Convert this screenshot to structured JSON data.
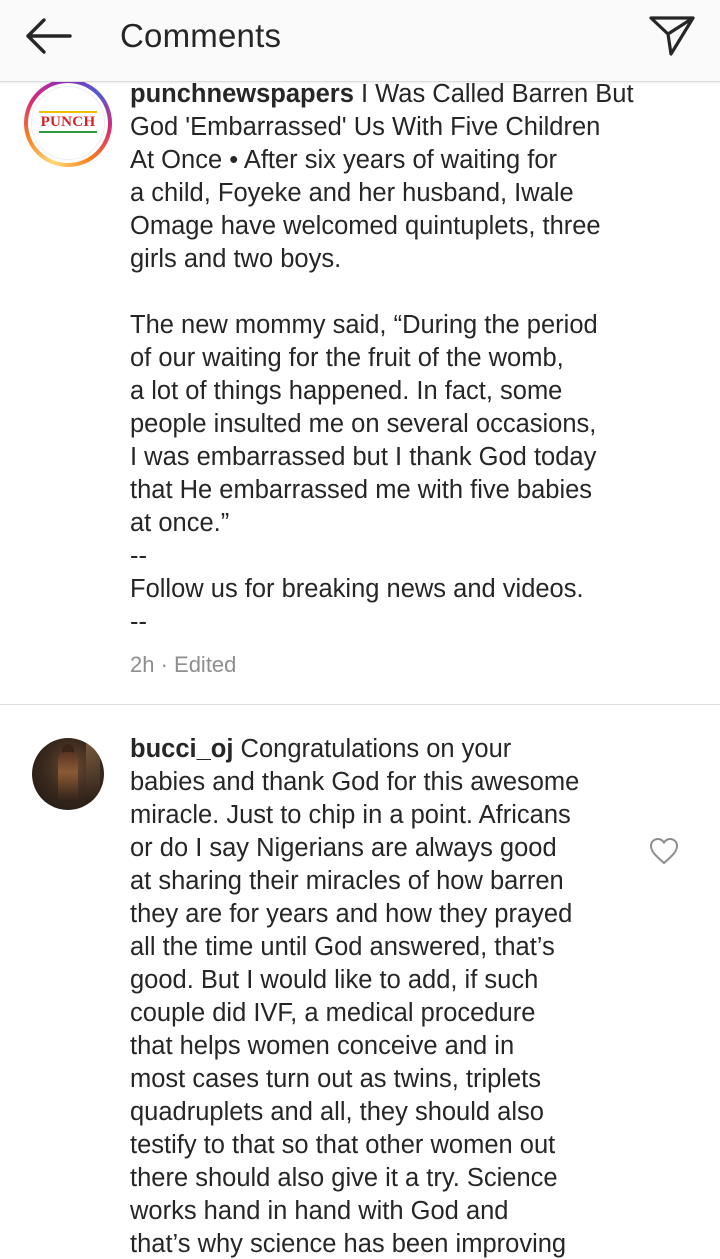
{
  "header": {
    "title": "Comments",
    "back_icon": "arrow-left-icon",
    "direct_icon": "paper-plane-icon"
  },
  "caption": {
    "username": "punchnewspapers",
    "lines": [
      " I Was Called Barren But",
      "God 'Embarrassed' Us With Five Children",
      "At Once • After six years of waiting for",
      "a child, Foyeke and her husband, Iwale",
      "Omage have welcomed quintuplets, three",
      "girls and two boys.",
      "",
      "The new mommy said, “During the period",
      "of our waiting for the fruit of the womb,",
      "a lot of things happened. In fact, some",
      "people insulted me on several occasions,",
      "I was embarrassed but I thank God today",
      "that He embarrassed me with five babies",
      "at once.”",
      "--",
      "Follow us for breaking news and videos.",
      "--"
    ],
    "timestamp": "2h · Edited",
    "avatar_logo_text": "PUNCH"
  },
  "comment": {
    "username": "bucci_oj",
    "lines": [
      " Congratulations on your",
      "babies and thank God for this awesome",
      "miracle. Just to chip in a point. Africans",
      "or do I say Nigerians are always good",
      "at sharing their miracles of how barren",
      "they are for years and how they prayed",
      "all the time until God answered, that’s",
      "good. But I would like to add, if such",
      "couple did IVF, a medical procedure",
      "that helps women conceive and in",
      "most cases turn out as twins, triplets",
      "quadruplets and all, they should also",
      "testify to that so that other women out",
      "there should also give it a try. Science",
      "works hand in hand with God and",
      "that’s why science has been improving"
    ],
    "like_icon": "heart-outline-icon"
  }
}
